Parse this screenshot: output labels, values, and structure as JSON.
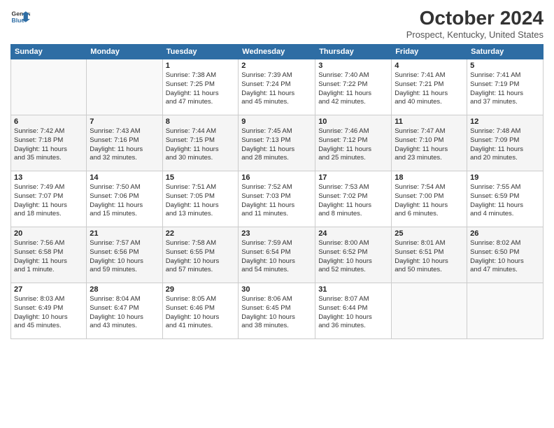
{
  "logo": {
    "line1": "General",
    "line2": "Blue"
  },
  "title": "October 2024",
  "location": "Prospect, Kentucky, United States",
  "weekdays": [
    "Sunday",
    "Monday",
    "Tuesday",
    "Wednesday",
    "Thursday",
    "Friday",
    "Saturday"
  ],
  "weeks": [
    [
      {
        "day": "",
        "info": ""
      },
      {
        "day": "",
        "info": ""
      },
      {
        "day": "1",
        "info": "Sunrise: 7:38 AM\nSunset: 7:25 PM\nDaylight: 11 hours\nand 47 minutes."
      },
      {
        "day": "2",
        "info": "Sunrise: 7:39 AM\nSunset: 7:24 PM\nDaylight: 11 hours\nand 45 minutes."
      },
      {
        "day": "3",
        "info": "Sunrise: 7:40 AM\nSunset: 7:22 PM\nDaylight: 11 hours\nand 42 minutes."
      },
      {
        "day": "4",
        "info": "Sunrise: 7:41 AM\nSunset: 7:21 PM\nDaylight: 11 hours\nand 40 minutes."
      },
      {
        "day": "5",
        "info": "Sunrise: 7:41 AM\nSunset: 7:19 PM\nDaylight: 11 hours\nand 37 minutes."
      }
    ],
    [
      {
        "day": "6",
        "info": "Sunrise: 7:42 AM\nSunset: 7:18 PM\nDaylight: 11 hours\nand 35 minutes."
      },
      {
        "day": "7",
        "info": "Sunrise: 7:43 AM\nSunset: 7:16 PM\nDaylight: 11 hours\nand 32 minutes."
      },
      {
        "day": "8",
        "info": "Sunrise: 7:44 AM\nSunset: 7:15 PM\nDaylight: 11 hours\nand 30 minutes."
      },
      {
        "day": "9",
        "info": "Sunrise: 7:45 AM\nSunset: 7:13 PM\nDaylight: 11 hours\nand 28 minutes."
      },
      {
        "day": "10",
        "info": "Sunrise: 7:46 AM\nSunset: 7:12 PM\nDaylight: 11 hours\nand 25 minutes."
      },
      {
        "day": "11",
        "info": "Sunrise: 7:47 AM\nSunset: 7:10 PM\nDaylight: 11 hours\nand 23 minutes."
      },
      {
        "day": "12",
        "info": "Sunrise: 7:48 AM\nSunset: 7:09 PM\nDaylight: 11 hours\nand 20 minutes."
      }
    ],
    [
      {
        "day": "13",
        "info": "Sunrise: 7:49 AM\nSunset: 7:07 PM\nDaylight: 11 hours\nand 18 minutes."
      },
      {
        "day": "14",
        "info": "Sunrise: 7:50 AM\nSunset: 7:06 PM\nDaylight: 11 hours\nand 15 minutes."
      },
      {
        "day": "15",
        "info": "Sunrise: 7:51 AM\nSunset: 7:05 PM\nDaylight: 11 hours\nand 13 minutes."
      },
      {
        "day": "16",
        "info": "Sunrise: 7:52 AM\nSunset: 7:03 PM\nDaylight: 11 hours\nand 11 minutes."
      },
      {
        "day": "17",
        "info": "Sunrise: 7:53 AM\nSunset: 7:02 PM\nDaylight: 11 hours\nand 8 minutes."
      },
      {
        "day": "18",
        "info": "Sunrise: 7:54 AM\nSunset: 7:00 PM\nDaylight: 11 hours\nand 6 minutes."
      },
      {
        "day": "19",
        "info": "Sunrise: 7:55 AM\nSunset: 6:59 PM\nDaylight: 11 hours\nand 4 minutes."
      }
    ],
    [
      {
        "day": "20",
        "info": "Sunrise: 7:56 AM\nSunset: 6:58 PM\nDaylight: 11 hours\nand 1 minute."
      },
      {
        "day": "21",
        "info": "Sunrise: 7:57 AM\nSunset: 6:56 PM\nDaylight: 10 hours\nand 59 minutes."
      },
      {
        "day": "22",
        "info": "Sunrise: 7:58 AM\nSunset: 6:55 PM\nDaylight: 10 hours\nand 57 minutes."
      },
      {
        "day": "23",
        "info": "Sunrise: 7:59 AM\nSunset: 6:54 PM\nDaylight: 10 hours\nand 54 minutes."
      },
      {
        "day": "24",
        "info": "Sunrise: 8:00 AM\nSunset: 6:52 PM\nDaylight: 10 hours\nand 52 minutes."
      },
      {
        "day": "25",
        "info": "Sunrise: 8:01 AM\nSunset: 6:51 PM\nDaylight: 10 hours\nand 50 minutes."
      },
      {
        "day": "26",
        "info": "Sunrise: 8:02 AM\nSunset: 6:50 PM\nDaylight: 10 hours\nand 47 minutes."
      }
    ],
    [
      {
        "day": "27",
        "info": "Sunrise: 8:03 AM\nSunset: 6:49 PM\nDaylight: 10 hours\nand 45 minutes."
      },
      {
        "day": "28",
        "info": "Sunrise: 8:04 AM\nSunset: 6:47 PM\nDaylight: 10 hours\nand 43 minutes."
      },
      {
        "day": "29",
        "info": "Sunrise: 8:05 AM\nSunset: 6:46 PM\nDaylight: 10 hours\nand 41 minutes."
      },
      {
        "day": "30",
        "info": "Sunrise: 8:06 AM\nSunset: 6:45 PM\nDaylight: 10 hours\nand 38 minutes."
      },
      {
        "day": "31",
        "info": "Sunrise: 8:07 AM\nSunset: 6:44 PM\nDaylight: 10 hours\nand 36 minutes."
      },
      {
        "day": "",
        "info": ""
      },
      {
        "day": "",
        "info": ""
      }
    ]
  ]
}
